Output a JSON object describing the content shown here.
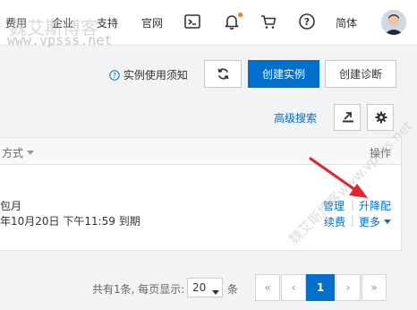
{
  "header": {
    "nav": [
      "费用",
      "企业",
      "支持",
      "官网"
    ],
    "lang": "简体",
    "icons": [
      "terminal-icon",
      "bell-icon",
      "cart-icon",
      "help-icon"
    ],
    "accent": "#ff7a00"
  },
  "watermark": {
    "top_text": "魏艾斯博客",
    "url_text": "www.vpsss.net",
    "diagonal_text": "魏艾斯博客www.vpsss.net"
  },
  "toolbar": {
    "notice_label": "实例使用须知",
    "create_instance_label": "创建实例",
    "create_diagnosis_label": "创建诊断",
    "advanced_search_label": "高级搜索"
  },
  "table": {
    "col_billing": "方式",
    "col_actions": "操作",
    "row": {
      "billing_type": "包月",
      "expiry": "年10月20日 下午11:59 到期",
      "action_manage": "管理",
      "action_resize": "升降配",
      "action_renew": "续费",
      "action_more": "更多"
    }
  },
  "pagination": {
    "summary": "共有1条, 每页显示:",
    "page_size": "20",
    "unit": "条",
    "current_page": "1",
    "first": "«",
    "prev": "‹",
    "next": "›",
    "last": "»"
  },
  "colors": {
    "primary": "#0070cc",
    "arrow": "#e8222a"
  }
}
